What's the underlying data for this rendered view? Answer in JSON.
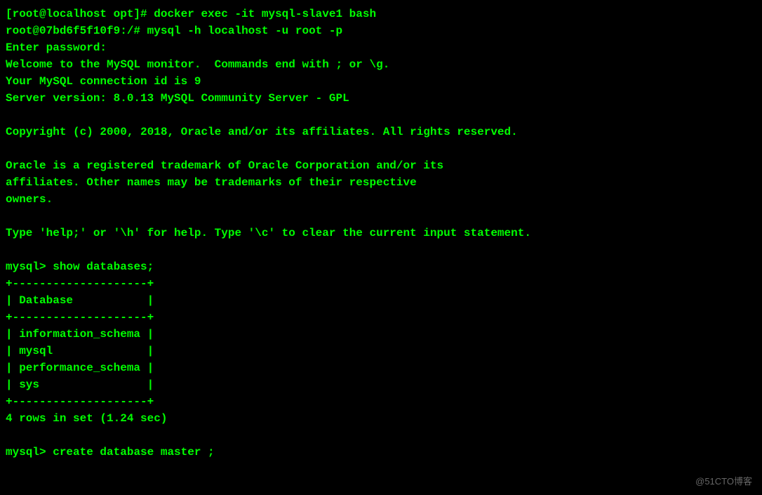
{
  "terminal": {
    "prompt1": "[root@localhost opt]# ",
    "cmd1": "docker exec -it mysql-slave1 bash",
    "prompt2": "root@07bd6f5f10f9:/# ",
    "cmd2": "mysql -h localhost -u root -p",
    "password_prompt": "Enter password:",
    "welcome1": "Welcome to the MySQL monitor.  Commands end with ; or \\g.",
    "welcome2": "Your MySQL connection id is 9",
    "welcome3": "Server version: 8.0.13 MySQL Community Server - GPL",
    "copyright": "Copyright (c) 2000, 2018, Oracle and/or its affiliates. All rights reserved.",
    "trademark1": "Oracle is a registered trademark of Oracle Corporation and/or its",
    "trademark2": "affiliates. Other names may be trademarks of their respective",
    "trademark3": "owners.",
    "help": "Type 'help;' or '\\h' for help. Type '\\c' to clear the current input statement.",
    "mysql_prompt": "mysql> ",
    "cmd3": "show databases;",
    "table_border": "+--------------------+",
    "table_header": "| Database           |",
    "table_row1": "| information_schema |",
    "table_row2": "| mysql              |",
    "table_row3": "| performance_schema |",
    "table_row4": "| sys                |",
    "result": "4 rows in set (1.24 sec)",
    "cmd4": "create database master ;"
  },
  "watermark": "@51CTO博客"
}
